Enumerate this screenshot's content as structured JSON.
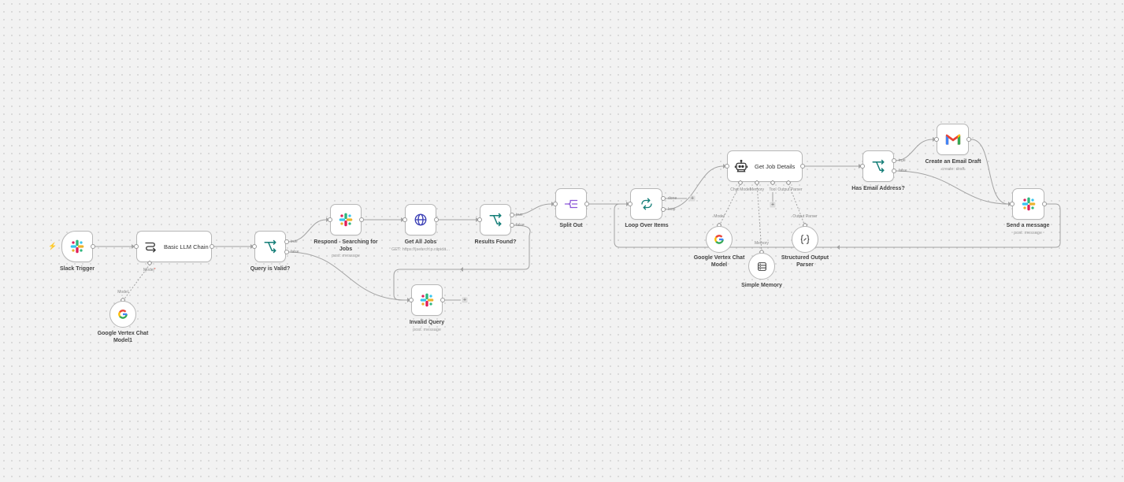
{
  "colors": {
    "canvas_bg": "#f2f2f2",
    "edge": "#a3a3a3",
    "if_teal": "#137d77",
    "http_blue": "#3b3fb5",
    "split_purple": "#8b56d6",
    "trigger_bolt": "#f07a2b",
    "slack_red": "#e01e5a",
    "slack_blue": "#36c5f0",
    "slack_green": "#2eb67d",
    "slack_yellow": "#ecb22e"
  },
  "nodes": {
    "slack_trigger": {
      "label": "Slack Trigger",
      "icon": "slack-icon"
    },
    "basic_llm_chain": {
      "label": "Basic LLM Chain",
      "icon": "chain-icon",
      "port_model": "Model",
      "port_required": "*"
    },
    "vertex_model_1": {
      "label": "Google Vertex Chat Model1",
      "icon": "google-icon",
      "port_model": "Model"
    },
    "query_valid": {
      "label": "Query is Valid?",
      "icon": "if-branch-icon",
      "true_label": "true",
      "false_label": "false"
    },
    "respond_searching": {
      "label": "Respond - Searching for Jobs",
      "sublabel": "post: message",
      "icon": "slack-icon"
    },
    "get_all_jobs": {
      "label": "Get All Jobs",
      "sublabel": "GET: https://jsearch.p.rapida...",
      "icon": "globe-icon"
    },
    "results_found": {
      "label": "Results Found?",
      "icon": "if-branch-icon",
      "true_label": "true",
      "false_label": "false"
    },
    "invalid_query": {
      "label": "Invalid Query",
      "sublabel": "post: message",
      "icon": "slack-icon"
    },
    "split_out": {
      "label": "Split Out",
      "icon": "split-icon"
    },
    "loop_over_items": {
      "label": "Loop Over Items",
      "icon": "loop-icon",
      "done_label": "done",
      "loop_label": "loop"
    },
    "get_job_details": {
      "label": "Get Job Details",
      "icon": "robot-icon",
      "port_chat_model": "Chat Model",
      "port_memory": "Memory",
      "port_tool": "Tool",
      "port_output_parser": "Output Parser"
    },
    "vertex_model": {
      "label": "Google Vertex Chat Model",
      "icon": "google-icon",
      "port_model": "Model"
    },
    "simple_memory": {
      "label": "Simple Memory",
      "icon": "database-icon",
      "port_memory": "Memory"
    },
    "structured_parser": {
      "label": "Structured Output Parser",
      "icon": "braces-icon",
      "port_output_parser": "Output Parser"
    },
    "has_email": {
      "label": "Has Email Address?",
      "icon": "if-branch-icon",
      "true_label": "true",
      "false_label": "false"
    },
    "create_email_draft": {
      "label": "Create an Email Draft",
      "sublabel": "create: draft",
      "icon": "gmail-icon"
    },
    "send_message": {
      "label": "Send a message",
      "sublabel": "post: message",
      "icon": "slack-icon"
    }
  },
  "add_button": "+"
}
